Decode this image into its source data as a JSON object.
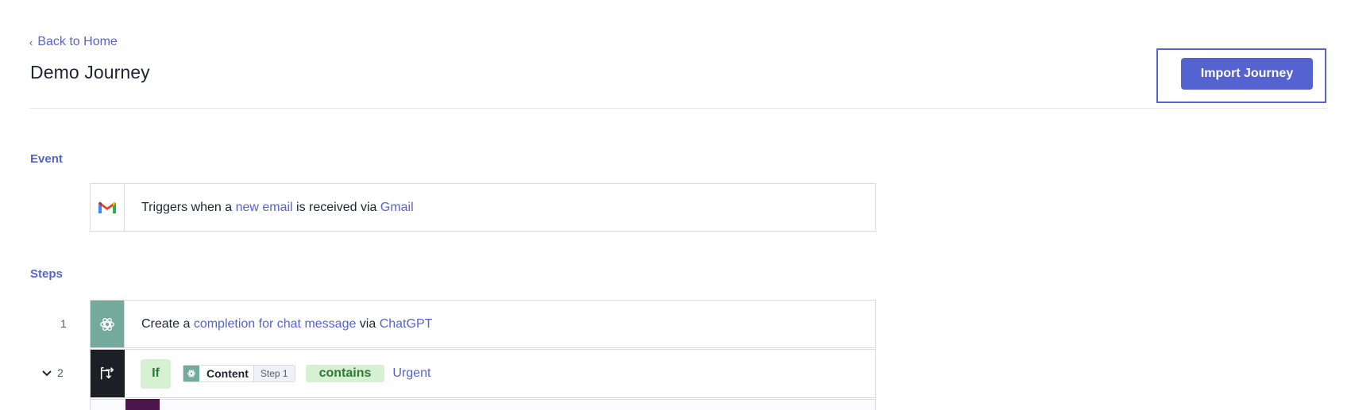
{
  "header": {
    "back_label": "Back to Home",
    "title": "Demo Journey",
    "import_label": "Import Journey"
  },
  "event": {
    "section_label": "Event",
    "prefix": "Triggers when a ",
    "trigger": "new email",
    "middle": " is received via ",
    "app": "Gmail"
  },
  "steps": {
    "section_label": "Steps",
    "step1": {
      "number": "1",
      "prefix": "Create a ",
      "action": "completion for chat message",
      "middle": " via ",
      "app": "ChatGPT"
    },
    "step2": {
      "number": "2",
      "if_label": "If",
      "field_label": "Content",
      "field_step": "Step 1",
      "operator": "contains",
      "value": "Urgent"
    }
  },
  "colors": {
    "accent": "#5563d1",
    "chatgpt": "#74aa9c",
    "condition_dark": "#1e1f24",
    "slack_purple": "#4a154b",
    "pill_green_bg": "#d6f0d2",
    "pill_green_text": "#2b7a36"
  }
}
